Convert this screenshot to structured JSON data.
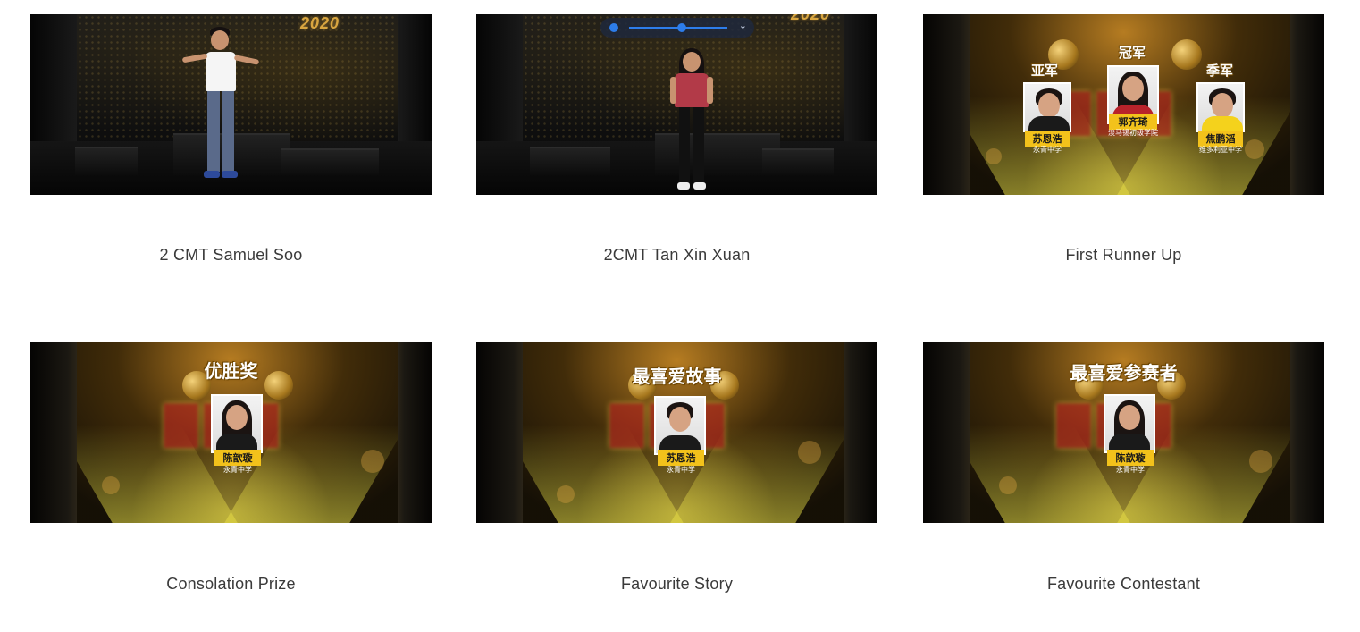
{
  "videos": [
    {
      "caption": "2 CMT Samuel Soo",
      "overlay_year": "2020"
    },
    {
      "caption": "2CMT Tan Xin Xuan",
      "overlay_year": "2020"
    },
    {
      "caption": "First Runner Up",
      "winners": [
        {
          "rank": "冠军",
          "name": "郭齐琦",
          "school": "淡马锡初级学院"
        },
        {
          "rank": "亚军",
          "name": "苏恩浩",
          "school": "永青中学"
        },
        {
          "rank": "季军",
          "name": "焦鹏滔",
          "school": "维多利亚中学"
        }
      ]
    },
    {
      "caption": "Consolation Prize",
      "award_title": "优胜奖",
      "name": "陈歆璇",
      "school": "永青中学"
    },
    {
      "caption": "Favourite Story",
      "award_title": "最喜爱故事",
      "name": "苏恩浩",
      "school": "永青中学"
    },
    {
      "caption": "Favourite Contestant",
      "award_title": "最喜爱参赛者",
      "name": "陈歆璇",
      "school": "永青中学"
    }
  ],
  "colors": {
    "caption_text": "#3a3a3a",
    "name_tag": "#f3c21b",
    "video_control_accent": "#2d7dea"
  },
  "icons": [
    "play-icon",
    "chevron-down-icon"
  ]
}
